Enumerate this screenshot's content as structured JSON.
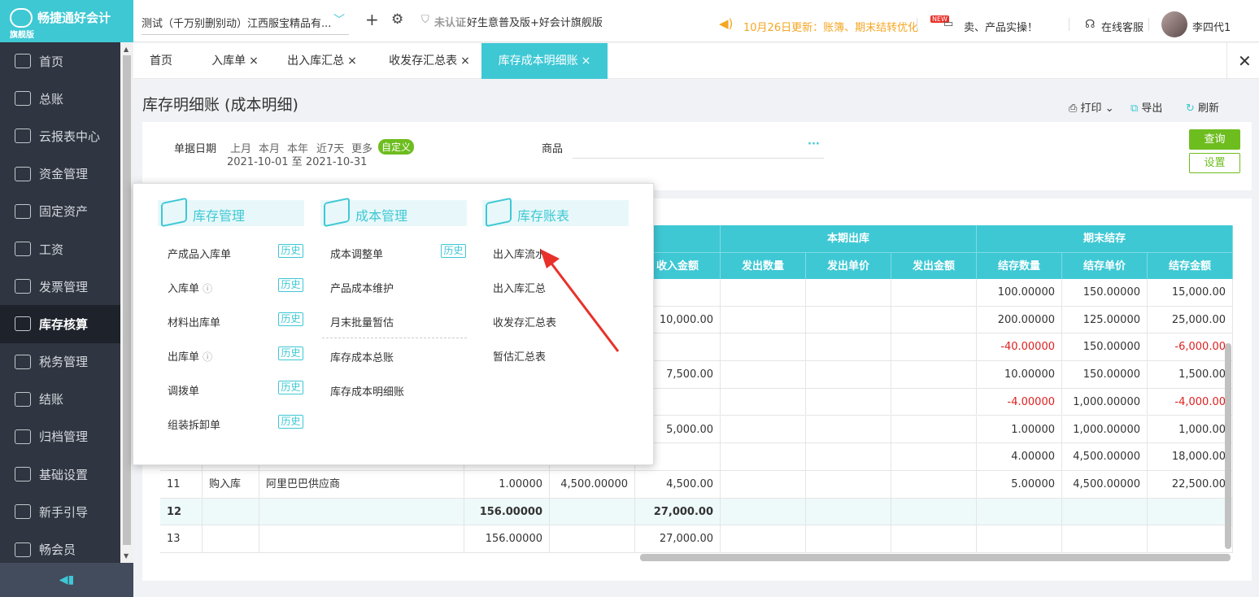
{
  "brand": {
    "name": "畅捷通好会计",
    "edition": "旗舰版"
  },
  "sidebar": {
    "items": [
      {
        "label": "首页"
      },
      {
        "label": "总账"
      },
      {
        "label": "云报表中心"
      },
      {
        "label": "资金管理"
      },
      {
        "label": "固定资产"
      },
      {
        "label": "工资"
      },
      {
        "label": "发票管理"
      },
      {
        "label": "库存核算"
      },
      {
        "label": "税务管理"
      },
      {
        "label": "结账"
      },
      {
        "label": "归档管理"
      },
      {
        "label": "基础设置"
      },
      {
        "label": "新手引导"
      },
      {
        "label": "畅会员"
      }
    ],
    "active": "库存核算"
  },
  "topbar": {
    "company": "测试（千万别删别动）江西服宝精品有...",
    "cert": "未认证",
    "product": "好生意普及版+好会计旗舰版",
    "notice": "10月26日更新：账簿、期末结转优化",
    "promo_badge": "NEW",
    "promo": "卖、产品实操！",
    "service": "在线客服",
    "user": "李四代1"
  },
  "tabs": [
    {
      "label": "首页"
    },
    {
      "label": "入库单"
    },
    {
      "label": "出入库汇总"
    },
    {
      "label": "收发存汇总表"
    },
    {
      "label": "库存成本明细账"
    }
  ],
  "tab_close": "×",
  "page": {
    "title": "库存明细账 (成本明细)",
    "print": "打印",
    "export": "导出",
    "refresh": "刷新"
  },
  "filter": {
    "date_label": "单据日期",
    "presets": [
      "上月",
      "本月",
      "本年",
      "近7天",
      "更多"
    ],
    "custom": "自定义",
    "date_range": "2021-10-01 至 2021-10-31",
    "goods_label": "商品",
    "goods_more": "···",
    "query": "查询",
    "settings": "设置"
  },
  "table": {
    "group_headers": [
      "本期出库",
      "期末结存"
    ],
    "col_headers": [
      "收入金额",
      "发出数量",
      "发出单价",
      "发出金额",
      "结存数量",
      "结存单价",
      "结存金额"
    ],
    "rows": [
      {
        "no": "",
        "type": "",
        "partner": "",
        "in_qty": "",
        "in_price": "",
        "in_amt": "",
        "out_qty": "",
        "out_price": "",
        "out_amt": "",
        "bal_qty": "100.00000",
        "bal_price": "150.00000",
        "bal_amt": "15,000.00",
        "neg": false,
        "total": false
      },
      {
        "no": "",
        "type": "",
        "partner": "",
        "in_qty": "",
        "in_price": "",
        "in_amt": "10,000.00",
        "out_qty": "",
        "out_price": "",
        "out_amt": "",
        "bal_qty": "200.00000",
        "bal_price": "125.00000",
        "bal_amt": "25,000.00",
        "neg": false,
        "total": false
      },
      {
        "no": "",
        "type": "",
        "partner": "",
        "in_qty": "",
        "in_price": "",
        "in_amt": "",
        "out_qty": "",
        "out_price": "",
        "out_amt": "",
        "bal_qty": "-40.00000",
        "bal_price": "150.00000",
        "bal_amt": "-6,000.00",
        "neg": true,
        "total": false
      },
      {
        "no": "",
        "type": "",
        "partner": "",
        "in_qty": "",
        "in_price": "",
        "in_amt": "7,500.00",
        "out_qty": "",
        "out_price": "",
        "out_amt": "",
        "bal_qty": "10.00000",
        "bal_price": "150.00000",
        "bal_amt": "1,500.00",
        "neg": false,
        "total": false
      },
      {
        "no": "",
        "type": "",
        "partner": "",
        "in_qty": "",
        "in_price": "",
        "in_amt": "",
        "out_qty": "",
        "out_price": "",
        "out_amt": "",
        "bal_qty": "-4.00000",
        "bal_price": "1,000.00000",
        "bal_amt": "-4,000.00",
        "neg": true,
        "total": false
      },
      {
        "no": "",
        "type": "",
        "partner": "",
        "in_qty": "",
        "in_price": "",
        "in_amt": "5,000.00",
        "out_qty": "",
        "out_price": "",
        "out_amt": "",
        "bal_qty": "1.00000",
        "bal_price": "1,000.00000",
        "bal_amt": "1,000.00",
        "neg": false,
        "total": false
      },
      {
        "no": "",
        "type": "",
        "partner": "",
        "in_qty": "",
        "in_price": "",
        "in_amt": "",
        "out_qty": "",
        "out_price": "",
        "out_amt": "",
        "bal_qty": "4.00000",
        "bal_price": "4,500.00000",
        "bal_amt": "18,000.00",
        "neg": false,
        "total": false
      },
      {
        "no": "11",
        "type": "购入库",
        "partner": "阿里巴巴供应商",
        "in_qty": "1.00000",
        "in_price": "4,500.00000",
        "in_amt": "4,500.00",
        "out_qty": "",
        "out_price": "",
        "out_amt": "",
        "bal_qty": "5.00000",
        "bal_price": "4,500.00000",
        "bal_amt": "22,500.00",
        "neg": false,
        "total": false
      },
      {
        "no": "12",
        "type": "",
        "partner": "",
        "in_qty": "156.00000",
        "in_price": "",
        "in_amt": "27,000.00",
        "out_qty": "",
        "out_price": "",
        "out_amt": "",
        "bal_qty": "",
        "bal_price": "",
        "bal_amt": "",
        "neg": false,
        "total": true
      },
      {
        "no": "13",
        "type": "",
        "partner": "",
        "in_qty": "156.00000",
        "in_price": "",
        "in_amt": "27,000.00",
        "out_qty": "",
        "out_price": "",
        "out_amt": "",
        "bal_qty": "",
        "bal_price": "",
        "bal_amt": "",
        "neg": false,
        "total": false
      }
    ]
  },
  "menu": {
    "sections": [
      {
        "title": "库存管理",
        "items": [
          {
            "label": "产成品入库单",
            "badge": "历史"
          },
          {
            "label": "入库单",
            "badge": "历史"
          },
          {
            "label": "材料出库单",
            "badge": "历史"
          },
          {
            "label": "出库单",
            "badge": "历史"
          },
          {
            "label": "调拨单",
            "badge": "历史"
          },
          {
            "label": "组装拆卸单",
            "badge": "历史"
          }
        ]
      },
      {
        "title": "成本管理",
        "items": [
          {
            "label": "成本调整单",
            "badge": "历史"
          },
          {
            "label": "产品成本维护"
          },
          {
            "label": "月末批量暂估"
          },
          {
            "label": "库存成本总账"
          },
          {
            "label": "库存成本明细账"
          }
        ]
      },
      {
        "title": "库存账表",
        "items": [
          {
            "label": "出入库流水"
          },
          {
            "label": "出入库汇总"
          },
          {
            "label": "收发存汇总表"
          },
          {
            "label": "暂估汇总表"
          }
        ]
      }
    ]
  },
  "colors": {
    "accent": "#3ec8d4",
    "sidebar": "#2f3541",
    "green": "#6ebd1f",
    "notice": "#f5a623",
    "arrow": "#e8312a",
    "negative": "#e02020"
  }
}
